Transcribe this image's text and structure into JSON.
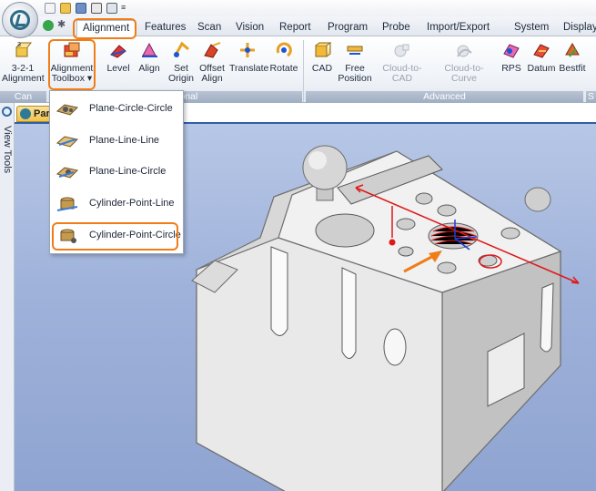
{
  "tabs": [
    "Alignment",
    "Features",
    "Scan",
    "Vision",
    "Report",
    "Program",
    "Probe",
    "Import/Export",
    "System",
    "Display"
  ],
  "active_tab": "Alignment",
  "ribbon": {
    "buttons": [
      {
        "id": "3-2-1",
        "label1": "3-2-1",
        "label2": "Alignment"
      },
      {
        "id": "toolbox",
        "label1": "Alignment",
        "label2": "Toolbox ▾"
      },
      {
        "id": "level",
        "label1": "Level",
        "label2": ""
      },
      {
        "id": "align",
        "label1": "Align",
        "label2": ""
      },
      {
        "id": "set-origin",
        "label1": "Set",
        "label2": "Origin"
      },
      {
        "id": "offset-align",
        "label1": "Offset",
        "label2": "Align"
      },
      {
        "id": "translate",
        "label1": "Translate",
        "label2": ""
      },
      {
        "id": "rotate",
        "label1": "Rotate",
        "label2": ""
      },
      {
        "id": "cad",
        "label1": "CAD",
        "label2": ""
      },
      {
        "id": "free-position",
        "label1": "Free",
        "label2": "Position"
      },
      {
        "id": "cloud-to-cad",
        "label1": "Cloud-to-CAD",
        "label2": ""
      },
      {
        "id": "cloud-to-curve",
        "label1": "Cloud-to-Curve",
        "label2": ""
      },
      {
        "id": "rps",
        "label1": "RPS",
        "label2": ""
      },
      {
        "id": "datum",
        "label1": "Datum",
        "label2": ""
      },
      {
        "id": "bestfit",
        "label1": "Bestfit",
        "label2": ""
      }
    ],
    "groups": [
      "Can",
      "Traditional",
      "Advanced",
      "S"
    ]
  },
  "dropdown_items": [
    "Plane-Circle-Circle",
    "Plane-Line-Line",
    "Plane-Line-Circle",
    "Cylinder-Point-Line",
    "Cylinder-Point-Circle"
  ],
  "highlighted_item": "Cylinder-Point-Circle",
  "side_panel": {
    "view_tools": "View Tools"
  },
  "doc_tab": "Par",
  "colors": {
    "highlight": "#f07d18",
    "accent": "#2f5fa8",
    "axis_red": "#e01818",
    "axis_blue": "#1a3fd6"
  }
}
